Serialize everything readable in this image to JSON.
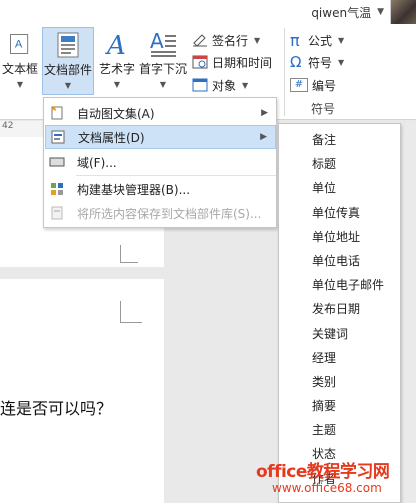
{
  "user": {
    "name": "qiwen气温"
  },
  "ribbon": {
    "textbox": "文本框",
    "docparts": "文档部件",
    "wordart": "艺术字",
    "dropcap": "首字下沉",
    "signature_line": "签名行",
    "datetime": "日期和时间",
    "object": "对象",
    "formula": "公式",
    "symbol": "符号",
    "numbering": "编号",
    "symbols_group": "符号"
  },
  "ruler": {
    "text": "42"
  },
  "menu": {
    "items": [
      {
        "label": "自动图文集(A)"
      },
      {
        "label": "文档属性(D)"
      },
      {
        "label": "域(F)..."
      },
      {
        "label": "构建基块管理器(B)..."
      },
      {
        "label": "将所选内容保存到文档部件库(S)..."
      }
    ]
  },
  "submenu": {
    "items": [
      "备注",
      "标题",
      "单位",
      "单位传真",
      "单位地址",
      "单位电话",
      "单位电子邮件",
      "发布日期",
      "关键词",
      "经理",
      "类别",
      "摘要",
      "主题",
      "状态",
      "作者"
    ]
  },
  "document": {
    "text": "连是否可以吗？"
  },
  "watermark": {
    "line1": "office教程学习网",
    "line2": "www.office68.com"
  }
}
